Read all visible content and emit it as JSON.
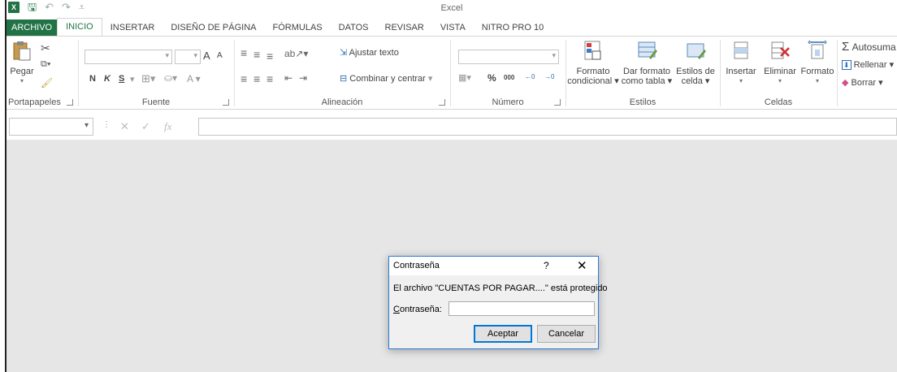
{
  "app": {
    "title": "Excel"
  },
  "tabs": [
    {
      "label": "ARCHIVO"
    },
    {
      "label": "INICIO"
    },
    {
      "label": "INSERTAR"
    },
    {
      "label": "DISEÑO DE PÁGINA"
    },
    {
      "label": "FÓRMULAS"
    },
    {
      "label": "DATOS"
    },
    {
      "label": "REVISAR"
    },
    {
      "label": "VISTA"
    },
    {
      "label": "NITRO PRO 10"
    }
  ],
  "ribbon": {
    "clipboard": {
      "label": "Portapapeles",
      "paste": "Pegar"
    },
    "font": {
      "label": "Fuente",
      "bold": "N",
      "italic": "K",
      "underline": "S",
      "grow": "A",
      "shrink": "A",
      "color": "A"
    },
    "alignment": {
      "label": "Alineación",
      "wrap": "Ajustar texto",
      "merge": "Combinar y centrar"
    },
    "number": {
      "label": "Número",
      "percent": "%",
      "thousands": "000",
      "inc_dec": "←0 .00",
      "dec_dec": ".00 →0"
    },
    "styles": {
      "label": "Estilos",
      "conditional_1": "Formato",
      "conditional_2": "condicional",
      "table_1": "Dar formato",
      "table_2": "como tabla",
      "cell_1": "Estilos de",
      "cell_2": "celda"
    },
    "cells": {
      "label": "Celdas",
      "insert": "Insertar",
      "delete": "Eliminar",
      "format": "Formato"
    },
    "editing": {
      "autosum": "Autosuma",
      "fill": "Rellenar",
      "clear": "Borrar"
    }
  },
  "formula_bar": {
    "cancel": "✕",
    "enter": "✓",
    "fx": "fx"
  },
  "dialog": {
    "title": "Contraseña",
    "help": "?",
    "close": "✕",
    "message": "El archivo \"CUENTAS POR PAGAR....\" está protegido",
    "field_label_first": "C",
    "field_label_rest": "ontraseña:",
    "field_value": "",
    "ok": "Aceptar",
    "cancel": "Cancelar"
  },
  "colors": {
    "accent": "#217346",
    "dialog_border": "#2b79d8",
    "workspace": "#e6e6e6"
  }
}
